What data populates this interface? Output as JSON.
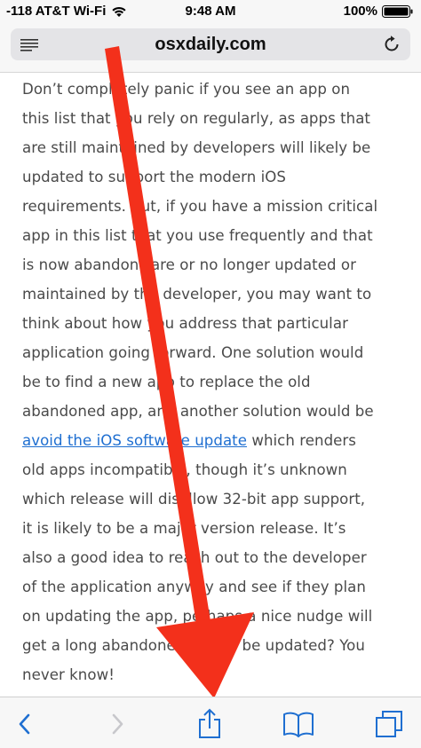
{
  "status_bar": {
    "carrier": "-118 AT&T Wi-Fi",
    "time": "9:48 AM",
    "battery": "100%"
  },
  "browser": {
    "url": "osxdaily.com"
  },
  "article": {
    "lines": [
      "Don’t completely panic if you see an app on",
      "this list that you rely on regularly, as apps that",
      "are still maintained by developers will likely be",
      "updated to support the modern iOS",
      "requirements. But, if you have a mission critical",
      "app in this list that you use frequently and that",
      "is now abandonware or no longer updated or",
      "maintained by the developer, you may want to",
      "think about how you address that particular",
      "application going forward. One solution would",
      "be to find a new app to replace the old",
      "abandoned app, and another solution would be"
    ],
    "link_text": "avoid the iOS software update",
    "after_link": " which renders",
    "lines_after": [
      "old apps incompatible, though it’s unknown",
      "which release will disallow 32-bit app support,",
      "it is likely to be a major version release. It’s",
      "also a good idea to reach out to the developer",
      "of the application anyway and see if they plan",
      "on updating the app, perhaps a nice nudge will",
      "get a long abandoned app to be updated? You",
      "never know!"
    ]
  },
  "colors": {
    "accent": "#1f6fd1",
    "arrow": "#f3301b",
    "toolbar_icon_disabled": "#c8c8cc"
  },
  "toolbar": {
    "icons": [
      "back-icon",
      "forward-icon",
      "share-icon",
      "bookmarks-icon",
      "tabs-icon"
    ]
  }
}
